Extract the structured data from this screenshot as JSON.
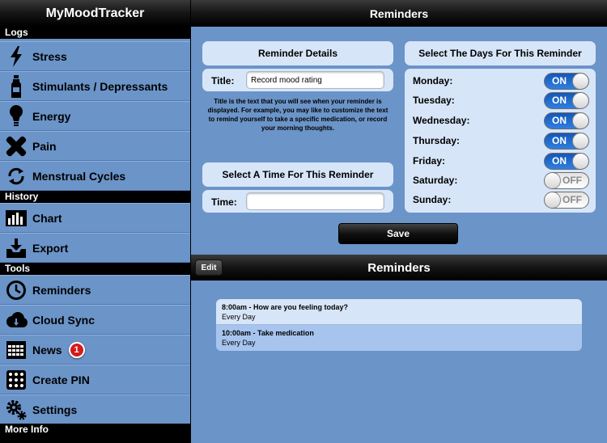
{
  "app": {
    "title": "MyMoodTracker"
  },
  "sidebar": {
    "sections": [
      {
        "header": "Logs",
        "items": [
          {
            "label": "Stress",
            "icon": "lightning-icon"
          },
          {
            "label": "Stimulants / Depressants",
            "icon": "bottle-icon"
          },
          {
            "label": "Energy",
            "icon": "lightbulb-icon"
          },
          {
            "label": "Pain",
            "icon": "bandage-icon"
          },
          {
            "label": "Menstrual Cycles",
            "icon": "cycle-icon"
          }
        ]
      },
      {
        "header": "History",
        "items": [
          {
            "label": "Chart",
            "icon": "bar-chart-icon"
          },
          {
            "label": "Export",
            "icon": "export-icon"
          }
        ]
      },
      {
        "header": "Tools",
        "items": [
          {
            "label": "Reminders",
            "icon": "clock-icon"
          },
          {
            "label": "Cloud Sync",
            "icon": "cloud-icon"
          },
          {
            "label": "News",
            "icon": "calendar-icon",
            "badge": "1"
          },
          {
            "label": "Create PIN",
            "icon": "keypad-icon"
          },
          {
            "label": "Settings",
            "icon": "gear-icon"
          }
        ]
      },
      {
        "header": "More Info",
        "items": []
      }
    ]
  },
  "detail": {
    "title": "Reminders",
    "details_panel": {
      "heading": "Reminder Details",
      "title_label": "Title:",
      "title_value": "Record mood rating",
      "help_text": "Title is the text that you will see when your reminder is displayed. For example, you may like to customize the text to remind yourself to take a specific medication, or record your morning thoughts."
    },
    "time_panel": {
      "heading": "Select A Time For This Reminder",
      "time_label": "Time:",
      "time_value": ""
    },
    "days_panel": {
      "heading": "Select The Days For This Reminder",
      "days": [
        {
          "label": "Monday:",
          "state": "ON",
          "on": true
        },
        {
          "label": "Tuesday:",
          "state": "ON",
          "on": true
        },
        {
          "label": "Wednesday:",
          "state": "ON",
          "on": true
        },
        {
          "label": "Thursday:",
          "state": "ON",
          "on": true
        },
        {
          "label": "Friday:",
          "state": "ON",
          "on": true
        },
        {
          "label": "Saturday:",
          "state": "OFF",
          "on": false
        },
        {
          "label": "Sunday:",
          "state": "OFF",
          "on": false
        }
      ]
    },
    "save_label": "Save",
    "list": {
      "title": "Reminders",
      "edit_label": "Edit",
      "items": [
        {
          "title": "8:00am - How are you feeling today?",
          "subtitle": "Every Day"
        },
        {
          "title": "10:00am - Take medication",
          "subtitle": "Every Day"
        }
      ]
    }
  },
  "colors": {
    "background": "#6b94c8",
    "panel": "#d7e5f8",
    "toggle_on": "#2f7fe0",
    "badge": "#d41b1b"
  }
}
